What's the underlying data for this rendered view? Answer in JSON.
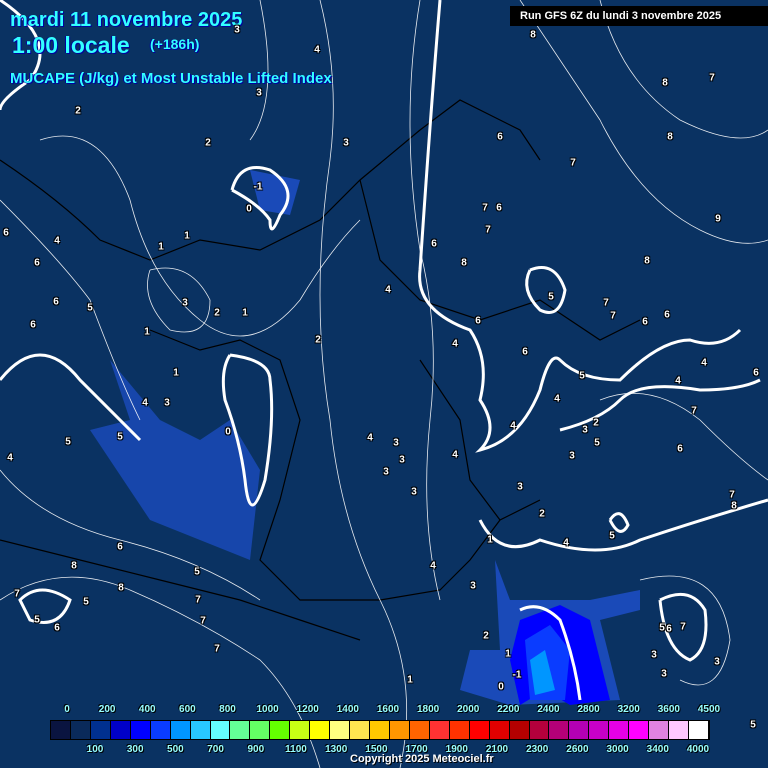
{
  "header": {
    "date": "mardi 11 novembre 2025",
    "time": "1:00 locale",
    "lead": "(+186h)",
    "parameter": "MUCAPE (J/kg) et Most Unstable Lifted Index",
    "run": "Run GFS 6Z du lundi 3 novembre 2025"
  },
  "legend": {
    "colors": [
      "#0a1440",
      "#0a2a5a",
      "#00308f",
      "#0000c8",
      "#0000ff",
      "#0a3cff",
      "#0096ff",
      "#28c8ff",
      "#64ffff",
      "#64ff96",
      "#64ff64",
      "#64ff00",
      "#c8ff14",
      "#ffff00",
      "#ffff80",
      "#ffe650",
      "#ffc800",
      "#ff9600",
      "#ff6400",
      "#ff3232",
      "#ff3200",
      "#ff0000",
      "#e10000",
      "#b40000",
      "#b4003c",
      "#b40078",
      "#b400b4",
      "#c800c8",
      "#e600e6",
      "#ff00ff",
      "#e182e1",
      "#ffc8ff",
      "#ffffff"
    ],
    "top_labels": [
      "0",
      "200",
      "400",
      "600",
      "800",
      "1000",
      "1200",
      "1400",
      "1600",
      "1800",
      "2000",
      "2200",
      "2400",
      "2800",
      "3200",
      "3600",
      "4500"
    ],
    "bottom_labels": [
      "100",
      "300",
      "500",
      "700",
      "900",
      "1100",
      "1300",
      "1500",
      "1700",
      "1900",
      "2100",
      "2300",
      "2600",
      "3000",
      "3400",
      "4000"
    ]
  },
  "lifted_index_labels": [
    "4",
    "3",
    "3",
    "2",
    "2",
    "3",
    "-1",
    "0",
    "6",
    "4",
    "1",
    "1",
    "6",
    "6",
    "5",
    "3",
    "2",
    "1",
    "6",
    "1",
    "2",
    "1",
    "4",
    "3",
    "0",
    "5",
    "5",
    "4",
    "4",
    "3",
    "3",
    "3",
    "3",
    "4",
    "4",
    "4",
    "6",
    "8",
    "7",
    "6",
    "7",
    "6",
    "7",
    "8",
    "8",
    "7",
    "8",
    "9",
    "8",
    "5",
    "7",
    "7",
    "6",
    "6",
    "6",
    "6",
    "5",
    "4",
    "4",
    "4",
    "4",
    "6",
    "7",
    "3",
    "2",
    "5",
    "3",
    "6",
    "3",
    "2",
    "5",
    "4",
    "1",
    "7",
    "8",
    "6",
    "8",
    "5",
    "8",
    "5",
    "7",
    "5",
    "6",
    "7",
    "7",
    "7",
    "4",
    "3",
    "2",
    "1",
    "-1",
    "0",
    "1",
    "5",
    "6",
    "7",
    "3",
    "3",
    "3",
    "5"
  ],
  "copyright": "Copyright 2025 Meteociel.fr"
}
